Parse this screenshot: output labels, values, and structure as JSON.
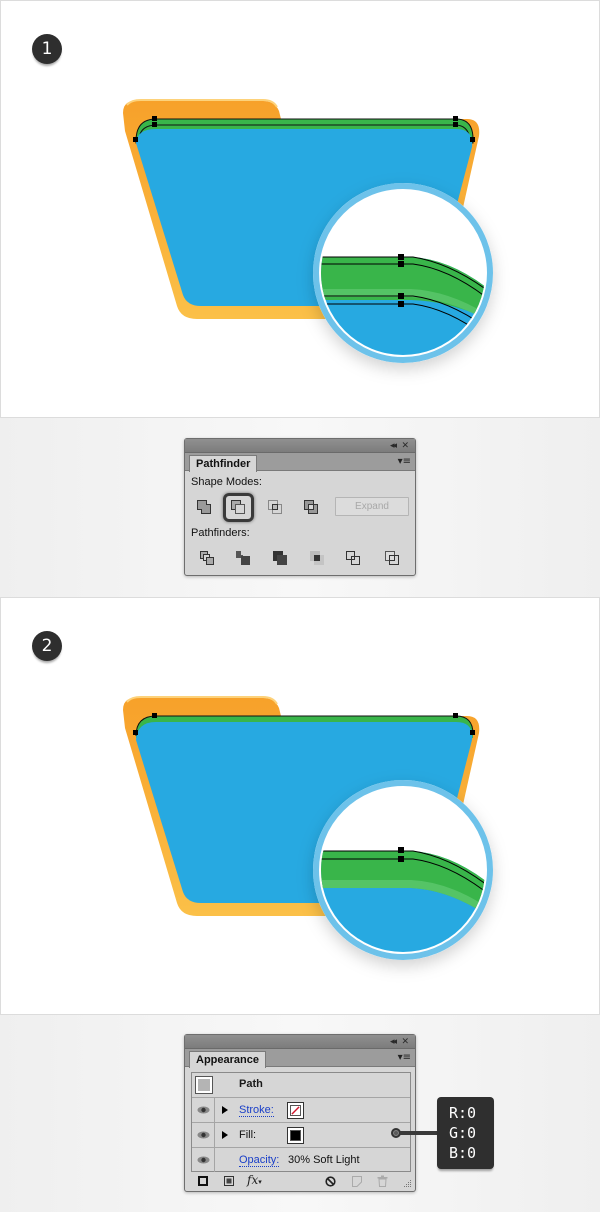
{
  "step1": {
    "badge": "1",
    "illustration": {
      "description": "folder-icon with green top band selected, magnifier showing two offset paths",
      "colors": {
        "folder_back": "#f8a72a",
        "folder_back_bottom": "#fbbd44",
        "folder_front": "#27a9e1",
        "green_band": "#39b54a",
        "green_highlight": "#5bc76b",
        "magnifier_ring": "#5dbbe8"
      }
    }
  },
  "pathfinder_panel": {
    "tab_label": "Pathfinder",
    "shape_modes_label": "Shape Modes:",
    "shape_modes": [
      "Unite",
      "Minus Front",
      "Intersect",
      "Exclude"
    ],
    "selected_shape_mode": "Minus Front",
    "expand_label": "Expand",
    "pathfinders_label": "Pathfinders:",
    "pathfinders": [
      "Divide",
      "Trim",
      "Merge",
      "Crop",
      "Outline",
      "Minus Back"
    ]
  },
  "step2": {
    "badge": "2",
    "illustration": {
      "description": "folder-icon with thin green top band after minus front, magnifier detail"
    }
  },
  "appearance_panel": {
    "tab_label": "Appearance",
    "object_label": "Path",
    "rows": [
      {
        "label": "Stroke:",
        "type": "stroke",
        "swatch": "none"
      },
      {
        "label": "Fill:",
        "type": "fill",
        "swatch": "#000000"
      },
      {
        "label": "Opacity:",
        "type": "opacity",
        "value": "30% Soft Light"
      }
    ],
    "footer_icons": [
      "add-new-stroke-icon",
      "add-new-fill-icon",
      "fx-icon",
      "clear-appearance-icon",
      "duplicate-item-icon",
      "delete-item-icon"
    ],
    "fx_label": "fx"
  },
  "rgb_callout": {
    "r": "R:0",
    "g": "G:0",
    "b": "B:0"
  },
  "title_bar": {
    "collapse_glyph": "◂◂",
    "close_glyph": "✕",
    "menu_glyph": "▾≡"
  }
}
